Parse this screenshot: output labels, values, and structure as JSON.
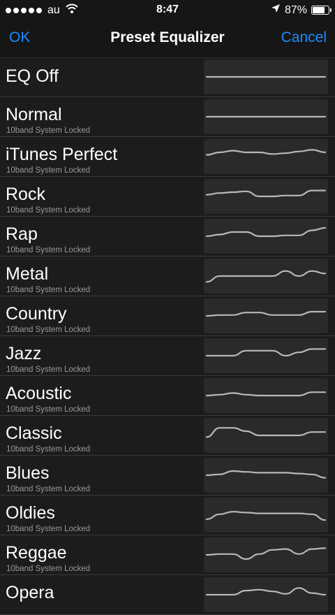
{
  "status_bar": {
    "carrier": "au",
    "time": "8:47",
    "battery_percent": "87%",
    "battery_level": 0.87,
    "signal_dots": 5,
    "icons": [
      "signal-dots-icon",
      "wifi-icon",
      "location-arrow-icon",
      "battery-icon"
    ]
  },
  "nav": {
    "ok_label": "OK",
    "title": "Preset Equalizer",
    "cancel_label": "Cancel"
  },
  "theme": {
    "accent": "#1a8cff",
    "background": "#1c1c1e",
    "preview_bg": "#2a2a2c",
    "curve": "#b8b8b8"
  },
  "presets": [
    {
      "name": "EQ Off",
      "subtitle": "",
      "bands": [
        0,
        0,
        0,
        0,
        0,
        0,
        0,
        0,
        0,
        0
      ]
    },
    {
      "name": "Normal",
      "subtitle": "10band System Locked",
      "bands": [
        0,
        0,
        0,
        0,
        0,
        0,
        0,
        0,
        0,
        0
      ]
    },
    {
      "name": "iTunes Perfect",
      "subtitle": "10band System Locked",
      "bands": [
        2,
        5,
        7,
        5,
        5,
        3,
        4,
        6,
        8,
        5
      ]
    },
    {
      "name": "Rock",
      "subtitle": "10band System Locked",
      "bands": [
        2,
        4,
        5,
        6,
        0,
        0,
        1,
        1,
        7,
        7
      ]
    },
    {
      "name": "Rap",
      "subtitle": "10band System Locked",
      "bands": [
        0,
        2,
        5,
        5,
        0,
        0,
        1,
        1,
        7,
        10
      ]
    },
    {
      "name": "Metal",
      "subtitle": "10band System Locked",
      "bands": [
        -7,
        0,
        0,
        0,
        0,
        0,
        6,
        0,
        6,
        3
      ]
    },
    {
      "name": "Country",
      "subtitle": "10band System Locked",
      "bands": [
        0,
        1,
        1,
        4,
        4,
        1,
        1,
        1,
        5,
        5
      ]
    },
    {
      "name": "Jazz",
      "subtitle": "10band System Locked",
      "bands": [
        0,
        0,
        0,
        6,
        6,
        6,
        0,
        4,
        8,
        8
      ]
    },
    {
      "name": "Acoustic",
      "subtitle": "10band System Locked",
      "bands": [
        0,
        1,
        3,
        1,
        0,
        0,
        0,
        0,
        4,
        4
      ]
    },
    {
      "name": "Classic",
      "subtitle": "10band System Locked",
      "bands": [
        -2,
        9,
        9,
        5,
        0,
        0,
        0,
        0,
        4,
        4
      ]
    },
    {
      "name": "Blues",
      "subtitle": "10band System Locked",
      "bands": [
        0,
        1,
        5,
        4,
        3,
        3,
        3,
        2,
        1,
        -3
      ]
    },
    {
      "name": "Oldies",
      "subtitle": "10band System Locked",
      "bands": [
        -5,
        1,
        4,
        3,
        2,
        2,
        2,
        2,
        1,
        -6
      ]
    },
    {
      "name": "Reggae",
      "subtitle": "10band System Locked",
      "bands": [
        0,
        1,
        1,
        -5,
        1,
        6,
        7,
        1,
        7,
        8
      ]
    },
    {
      "name": "Opera",
      "subtitle": "",
      "bands": [
        0,
        0,
        0,
        5,
        6,
        4,
        1,
        8,
        2,
        0
      ]
    }
  ]
}
